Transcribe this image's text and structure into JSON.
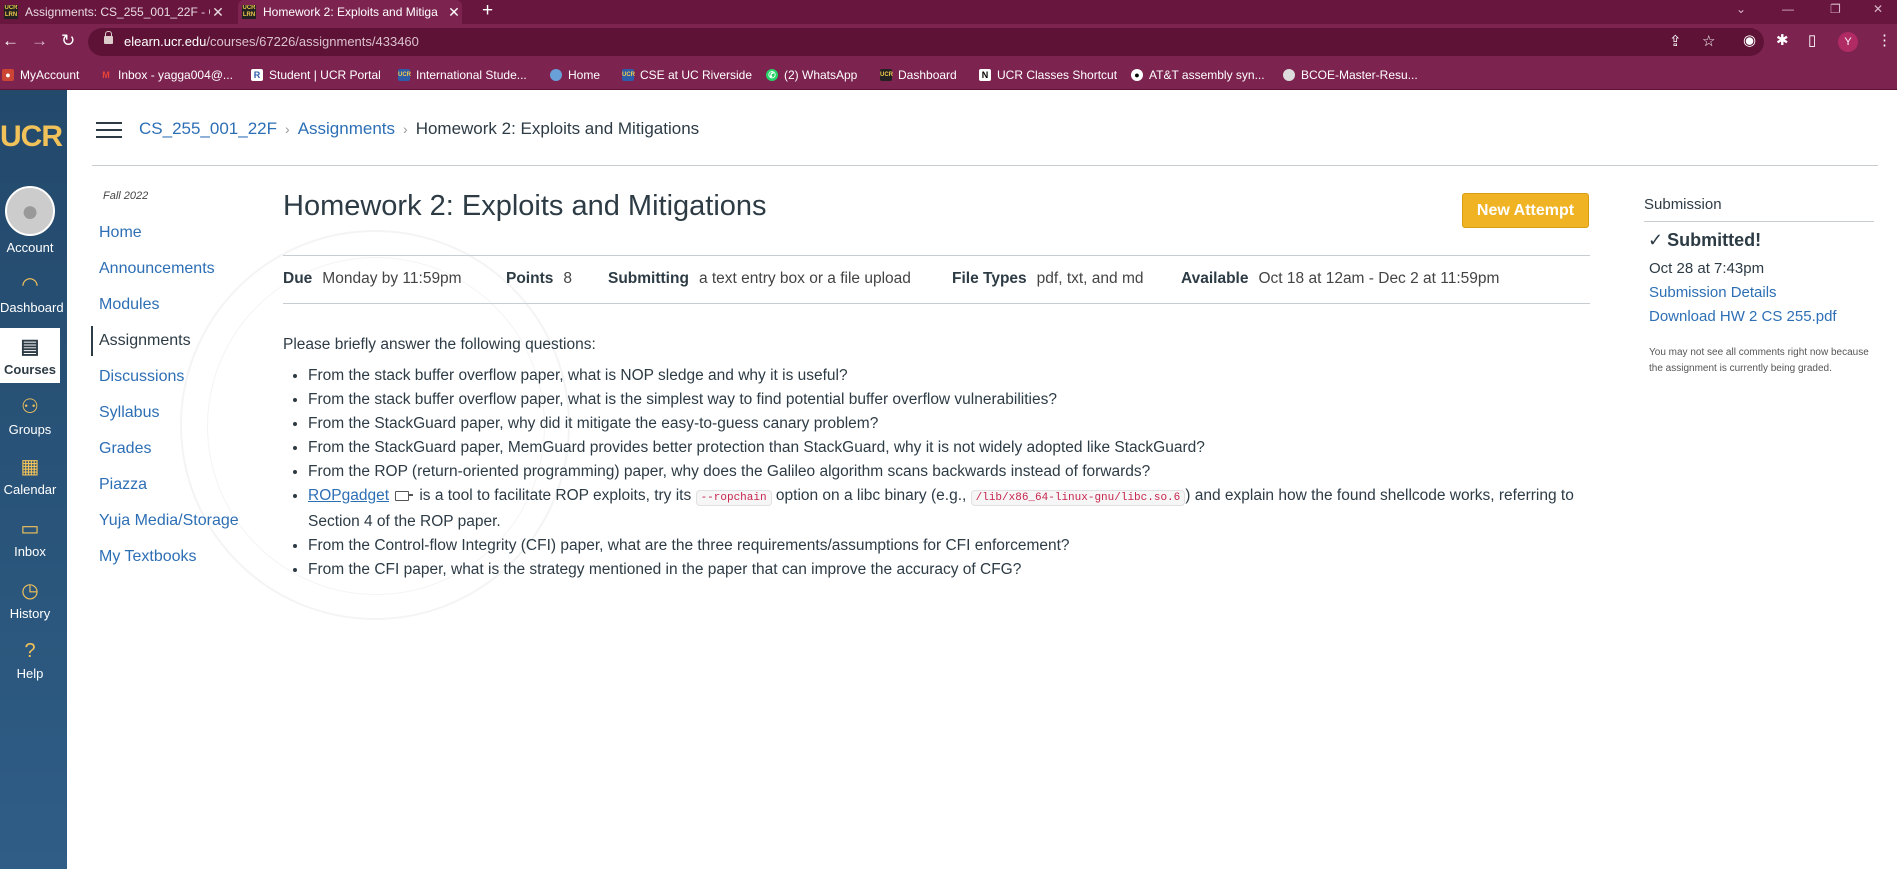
{
  "browser": {
    "tabs": [
      {
        "label": "Assignments: CS_255_001_22F - C",
        "favicon": "ucr-learn-icon"
      },
      {
        "label": "Homework 2: Exploits and Mitiga",
        "favicon": "ucr-learn-icon"
      }
    ],
    "url_host": "elearn.ucr.edu",
    "url_path": "/courses/67226/assignments/433460",
    "profile_initial": "Y",
    "bookmarks": [
      "MyAccount",
      "Inbox - yagga004@...",
      "Student | UCR Portal",
      "International Stude...",
      "Home",
      "CSE at UC Riverside",
      "(2) WhatsApp",
      "Dashboard",
      "UCR Classes Shortcut",
      "AT&T assembly syn...",
      "BCOE-Master-Resu..."
    ]
  },
  "global_nav": {
    "logo": "UCR",
    "items": [
      "Account",
      "Dashboard",
      "Courses",
      "Groups",
      "Calendar",
      "Inbox",
      "History",
      "Help"
    ]
  },
  "breadcrumb": {
    "course": "CS_255_001_22F",
    "section": "Assignments",
    "current": "Homework 2: Exploits and Mitigations"
  },
  "course_nav": {
    "term": "Fall 2022",
    "items": [
      "Home",
      "Announcements",
      "Modules",
      "Assignments",
      "Discussions",
      "Syllabus",
      "Grades",
      "Piazza",
      "Yuja Media/Storage",
      "My Textbooks"
    ],
    "active": "Assignments"
  },
  "assignment": {
    "title": "Homework 2: Exploits and Mitigations",
    "new_attempt_label": "New Attempt",
    "details": {
      "due_label": "Due",
      "due_value": "Monday by 11:59pm",
      "points_label": "Points",
      "points_value": "8",
      "submitting_label": "Submitting",
      "submitting_value": "a text entry box or a file upload",
      "filetypes_label": "File Types",
      "filetypes_value": "pdf, txt, and md",
      "available_label": "Available",
      "available_value": "Oct 18 at 12am - Dec 2 at 11:59pm"
    },
    "intro": "Please briefly answer the following questions:",
    "questions": [
      "From the stack buffer overflow paper, what is NOP sledge and why it is useful?",
      "From the stack buffer overflow paper, what is the simplest way to find potential buffer overflow vulnerabilities?",
      "From the StackGuard paper, why did it mitigate the easy-to-guess canary problem?",
      "From the StackGuard paper, MemGuard provides better protection than StackGuard, why it is not widely adopted like StackGuard?",
      "From the ROP (return-oriented programming) paper, why does the Galileo algorithm scans backwards instead of forwards?"
    ],
    "q6": {
      "link": "ROPgadget",
      "part1": "is a tool to facilitate ROP exploits, try its",
      "code1": "--ropchain",
      "part2": "option on a libc binary (e.g.,",
      "code2": "/lib/x86_64-linux-gnu/libc.so.6",
      "part3": ") and explain how the found shellcode works, referring to Section 4 of the ROP paper."
    },
    "questions_tail": [
      "From the Control-flow Integrity (CFI) paper, what are the three requirements/assumptions for CFI enforcement?",
      "From the CFI paper, what is the strategy mentioned in the paper that can improve the accuracy of CFG?"
    ]
  },
  "submission": {
    "heading": "Submission",
    "status": "Submitted!",
    "date": "Oct 28 at 7:43pm",
    "details_link": "Submission Details",
    "download_link": "Download HW 2 CS 255.pdf",
    "note": "You may not see all comments right now because the assignment is currently being graded."
  },
  "colors": {
    "chrome_bar": "#7d2350",
    "global_nav": "#2f5d86",
    "link": "#2d6fb5",
    "button": "#f0b323"
  }
}
